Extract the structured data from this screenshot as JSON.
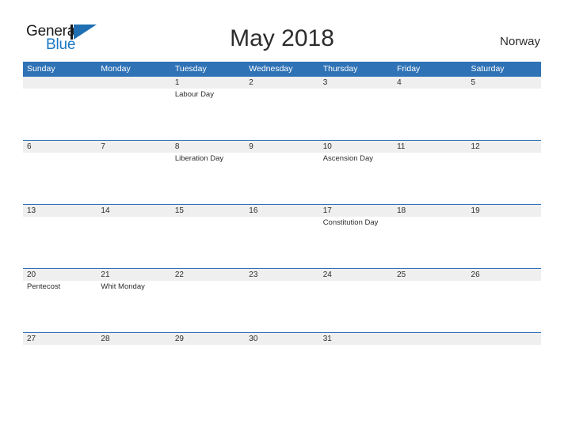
{
  "brand": {
    "name_part1": "General",
    "name_part2": "Blue",
    "accent_color": "#1f6fb2"
  },
  "header": {
    "title": "May 2018",
    "country": "Norway"
  },
  "calendar": {
    "header_bg": "#2f72b6",
    "stripe_bg": "#efefef",
    "weekdays": [
      "Sunday",
      "Monday",
      "Tuesday",
      "Wednesday",
      "Thursday",
      "Friday",
      "Saturday"
    ],
    "weeks": [
      [
        {
          "num": "",
          "event": ""
        },
        {
          "num": "",
          "event": ""
        },
        {
          "num": "1",
          "event": "Labour Day"
        },
        {
          "num": "2",
          "event": ""
        },
        {
          "num": "3",
          "event": ""
        },
        {
          "num": "4",
          "event": ""
        },
        {
          "num": "5",
          "event": ""
        }
      ],
      [
        {
          "num": "6",
          "event": ""
        },
        {
          "num": "7",
          "event": ""
        },
        {
          "num": "8",
          "event": "Liberation Day"
        },
        {
          "num": "9",
          "event": ""
        },
        {
          "num": "10",
          "event": "Ascension Day"
        },
        {
          "num": "11",
          "event": ""
        },
        {
          "num": "12",
          "event": ""
        }
      ],
      [
        {
          "num": "13",
          "event": ""
        },
        {
          "num": "14",
          "event": ""
        },
        {
          "num": "15",
          "event": ""
        },
        {
          "num": "16",
          "event": ""
        },
        {
          "num": "17",
          "event": "Constitution Day"
        },
        {
          "num": "18",
          "event": ""
        },
        {
          "num": "19",
          "event": ""
        }
      ],
      [
        {
          "num": "20",
          "event": "Pentecost"
        },
        {
          "num": "21",
          "event": "Whit Monday"
        },
        {
          "num": "22",
          "event": ""
        },
        {
          "num": "23",
          "event": ""
        },
        {
          "num": "24",
          "event": ""
        },
        {
          "num": "25",
          "event": ""
        },
        {
          "num": "26",
          "event": ""
        }
      ],
      [
        {
          "num": "27",
          "event": ""
        },
        {
          "num": "28",
          "event": ""
        },
        {
          "num": "29",
          "event": ""
        },
        {
          "num": "30",
          "event": ""
        },
        {
          "num": "31",
          "event": ""
        },
        {
          "num": "",
          "event": ""
        },
        {
          "num": "",
          "event": ""
        }
      ]
    ]
  }
}
